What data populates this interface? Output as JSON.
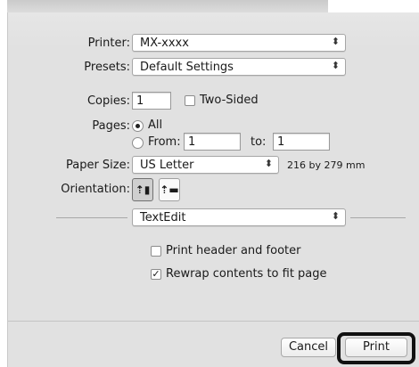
{
  "printer": {
    "label": "Printer:",
    "value": "MX-xxxx"
  },
  "presets": {
    "label": "Presets:",
    "value": "Default Settings"
  },
  "copies": {
    "label": "Copies:",
    "value": "1",
    "two_sided_label": "Two-Sided",
    "two_sided_checked": false
  },
  "pages": {
    "label": "Pages:",
    "all_label": "All",
    "from_label": "From:",
    "from_value": "1",
    "to_label": "to:",
    "to_value": "1",
    "selected": "All"
  },
  "paper_size": {
    "label": "Paper Size:",
    "value": "US Letter",
    "dimensions": "216 by 279 mm"
  },
  "orientation": {
    "label": "Orientation:",
    "options": [
      "portrait",
      "landscape"
    ],
    "selected": "portrait"
  },
  "app_section": {
    "value": "TextEdit"
  },
  "options": [
    {
      "label": "Print header and footer",
      "checked": false
    },
    {
      "label": "Rewrap contents to fit page",
      "checked": true
    }
  ],
  "buttons": {
    "cancel": "Cancel",
    "print": "Print"
  },
  "icons": {
    "popup_arrow": "updown-chevron-icon",
    "orient_portrait": "portrait-orientation-icon",
    "orient_landscape": "landscape-orientation-icon"
  }
}
